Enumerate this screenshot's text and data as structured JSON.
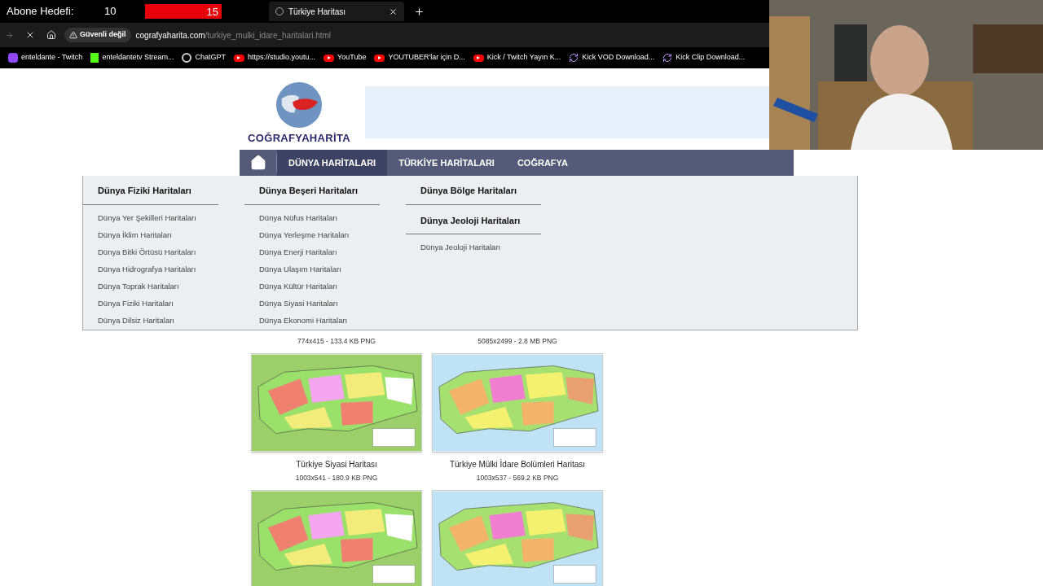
{
  "stream_overlay": {
    "label": "Abone Hedefi:",
    "current": "10",
    "goal": "15"
  },
  "tabs": [
    {
      "title": "Türkiye Haritası",
      "selected": true
    }
  ],
  "address_bar": {
    "security": "Güvenli değil",
    "domain": "cografyaharita.com",
    "path": "/turkiye_mulki_idare_haritalari.html"
  },
  "bookmarks": [
    {
      "label": "enteldante - Twitch",
      "kind": "twitch"
    },
    {
      "label": "enteldantetv Stream...",
      "kind": "kick"
    },
    {
      "label": "ChatGPT",
      "kind": "chatgpt"
    },
    {
      "label": "https://studio.youtu...",
      "kind": "youtube"
    },
    {
      "label": "YouTube",
      "kind": "youtube"
    },
    {
      "label": "YOUTUBER'lar için D...",
      "kind": "youtube"
    },
    {
      "label": "Kick / Twitch Yayın K...",
      "kind": "youtube"
    },
    {
      "label": "Kick VOD Download...",
      "kind": "sync"
    },
    {
      "label": "Kick Clip Download...",
      "kind": "sync"
    }
  ],
  "site": {
    "logo": "COĞRAFYAHARİTA",
    "nav": [
      {
        "label": "DÜNYA HARİTALARI",
        "selected": true
      },
      {
        "label": "TÜRKİYE HARİTALARI",
        "selected": false
      },
      {
        "label": "COĞRAFYA",
        "selected": false
      }
    ],
    "menu_columns": [
      {
        "sections": [
          {
            "title": "Dünya Fiziki Haritaları",
            "items": [
              "Dünya Yer Şekilleri Haritaları",
              "Dünya İklim Haritaları",
              "Dünya Bitki Örtüsü Haritaları",
              "Dünya Hidrografya Haritaları",
              "Dünya Toprak Haritaları",
              "Dünya Fiziki Haritaları",
              "Dünya Dilsiz Haritaları"
            ]
          }
        ]
      },
      {
        "sections": [
          {
            "title": "Dünya Beşeri Haritaları",
            "items": [
              "Dünya Nüfus Haritaları",
              "Dünya Yerleşme Haritaları",
              "Dünya Enerji Haritaları",
              "Dünya Ulaşım Haritaları",
              "Dünya Kültür Haritaları",
              "Dünya Siyasi Haritaları",
              "Dünya Ekonomi Haritaları"
            ]
          }
        ]
      },
      {
        "sections": [
          {
            "title": "Dünya Bölge Haritaları"
          },
          {
            "title": "Dünya Jeoloji Haritaları",
            "items": [
              "Dünya Jeoloji Haritaları"
            ]
          }
        ]
      }
    ],
    "gallery_rows": [
      [
        {
          "size": "774x415 - 133.4 KB PNG"
        },
        {
          "size": "5085x2499 - 2.8 MB PNG"
        }
      ],
      [
        {
          "kind": "picture",
          "title": "Türkiye Siyasi Haritası",
          "size": "1003x541 - 180.9 KB PNG"
        },
        {
          "kind": "picture",
          "title": "Türkiye Mülki İdare Bolümleri Haritası",
          "size": "1003x537 - 569.2 KB PNG"
        }
      ],
      [
        {
          "kind": "picture"
        },
        {
          "kind": "picture"
        }
      ]
    ]
  }
}
